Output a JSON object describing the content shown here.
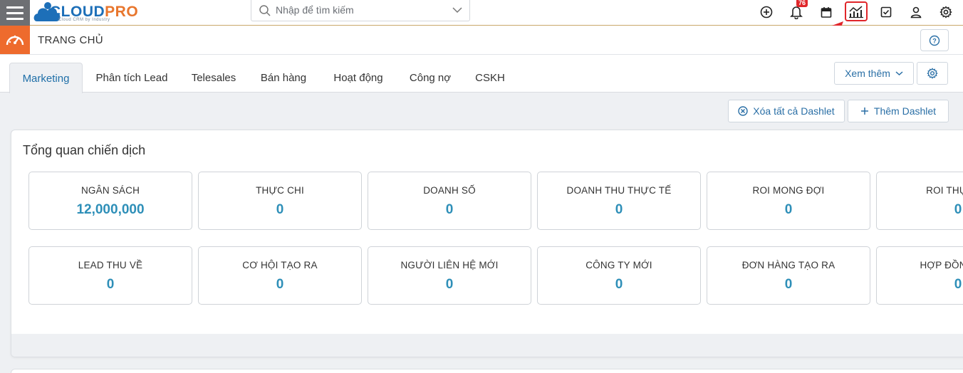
{
  "brand": {
    "part1": "CLOUD",
    "part2": "PRO",
    "tagline": "Cloud CRM by Industry"
  },
  "search": {
    "placeholder": "Nhập để tìm kiếm"
  },
  "toolbar": {
    "notifications_count": "76"
  },
  "header": {
    "title": "TRANG CHỦ"
  },
  "tabs": [
    {
      "label": "Marketing"
    },
    {
      "label": "Phân tích Lead"
    },
    {
      "label": "Telesales"
    },
    {
      "label": "Bán hàng"
    },
    {
      "label": "Hoạt động"
    },
    {
      "label": "Công nợ"
    },
    {
      "label": "CSKH"
    }
  ],
  "more_button": {
    "label": "Xem thêm"
  },
  "actions": {
    "clear_all": "Xóa tất cả Dashlet",
    "add": "Thêm Dashlet"
  },
  "dashlet": {
    "title": "Tổng quan chiến dịch",
    "row1": [
      {
        "label": "NGÂN SÁCH",
        "value": "12,000,000"
      },
      {
        "label": "THỰC CHI",
        "value": "0"
      },
      {
        "label": "DOANH SỐ",
        "value": "0"
      },
      {
        "label": "DOANH THU THỰC TẾ",
        "value": "0"
      },
      {
        "label": "ROI MONG ĐỢI",
        "value": "0"
      },
      {
        "label": "ROI THỰC TẾ",
        "value": "0"
      }
    ],
    "row2": [
      {
        "label": "LEAD THU VỀ",
        "value": "0"
      },
      {
        "label": "CƠ HỘI TẠO RA",
        "value": "0"
      },
      {
        "label": "NGƯỜI LIÊN HỆ MỚI",
        "value": "0"
      },
      {
        "label": "CÔNG TY MỚI",
        "value": "0"
      },
      {
        "label": "ĐƠN HÀNG TẠO RA",
        "value": "0"
      },
      {
        "label": "HỢP ĐỒNG MỚI",
        "value": "0"
      }
    ]
  },
  "colors": {
    "accent": "#2e8fb8",
    "brand_orange": "#ee6b2d",
    "highlight_red": "#e0262a"
  }
}
